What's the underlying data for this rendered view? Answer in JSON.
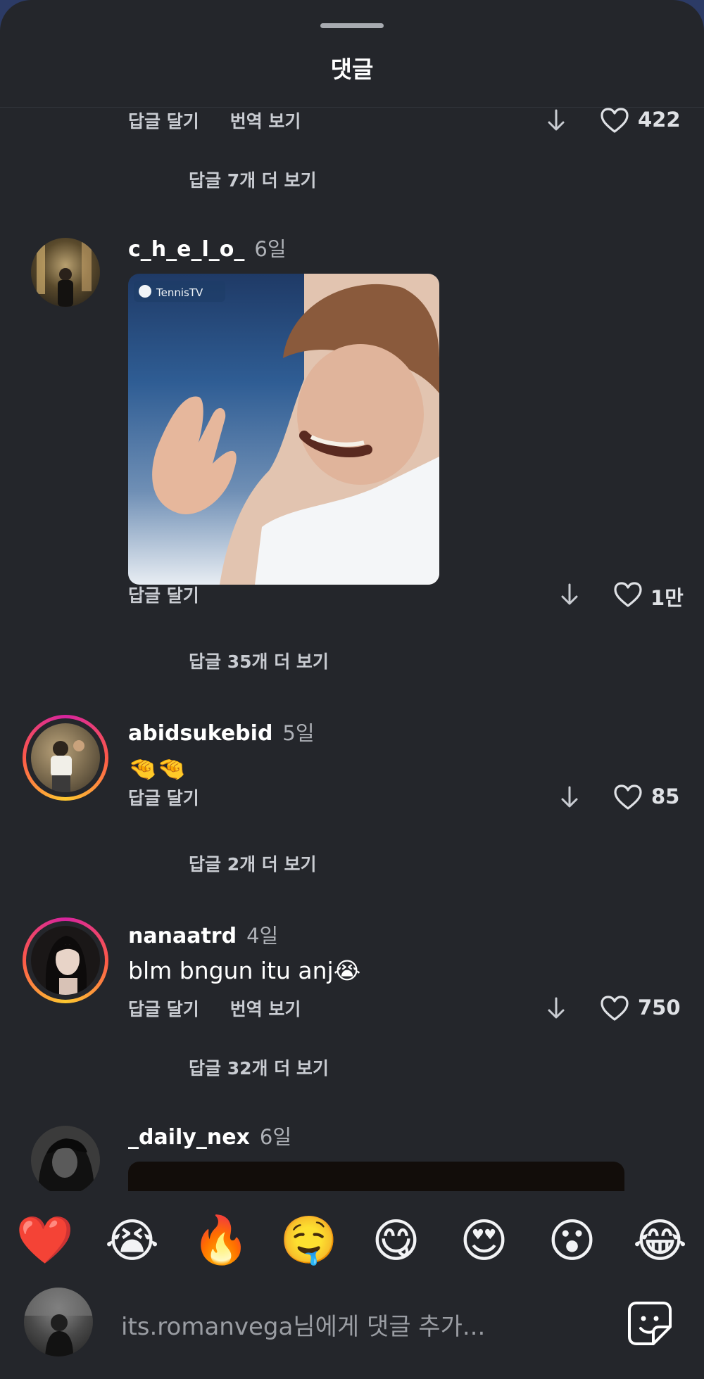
{
  "header": {
    "title": "댓글"
  },
  "actions": {
    "reply": "답글 달기",
    "translate": "번역 보기"
  },
  "comments": [
    {
      "likes": "422",
      "more_replies": "답글 7개 더 보기"
    },
    {
      "username": "c_h_e_l_o_",
      "time": "6일",
      "gif_badge": "TennisTV",
      "likes": "1만",
      "more_replies": "답글 35개 더 보기"
    },
    {
      "username": "abidsukebid",
      "time": "5일",
      "text": "🤏🤏",
      "likes": "85",
      "more_replies": "답글 2개 더 보기"
    },
    {
      "username": "nanaatrd",
      "time": "4일",
      "text": "blm bngun itu anj😭",
      "likes": "750",
      "more_replies": "답글 32개 더 보기"
    },
    {
      "username": "_daily_nex",
      "time": "6일"
    }
  ],
  "quick_reactions": [
    "❤️",
    "😭",
    "🔥",
    "🤤",
    "😋",
    "😍",
    "😮",
    "😂"
  ],
  "composer": {
    "placeholder": "its.romanvega님에게 댓글 추가..."
  },
  "colors": {
    "background": "#24262b",
    "text": "#ffffff",
    "muted": "#aeb1b7",
    "story_ring_start": "#d6249f",
    "story_ring_end": "#fdc830"
  },
  "icons": [
    "down-arrow-icon",
    "heart-outline-icon",
    "sticker-icon"
  ]
}
